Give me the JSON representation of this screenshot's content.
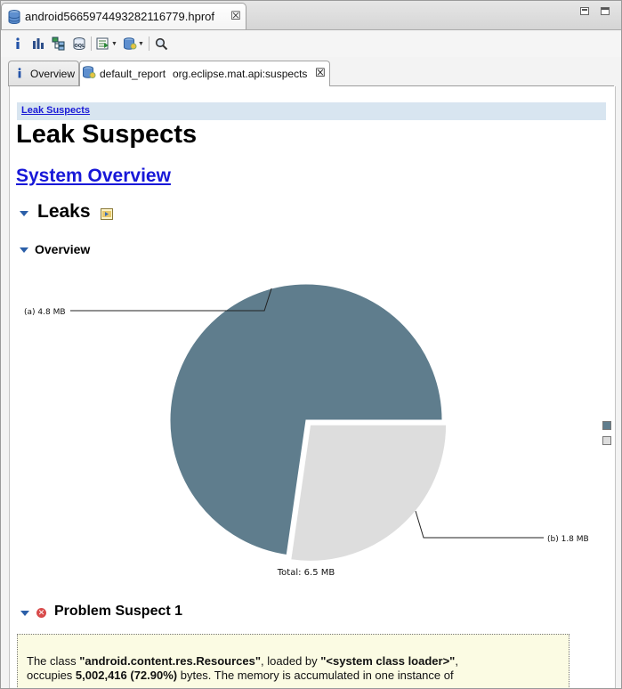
{
  "editor": {
    "file_tab": "android5665974493282116779.hprof"
  },
  "toolbar": {
    "icons": [
      "info-icon",
      "histogram-icon",
      "dominator-tree-icon",
      "oql-icon",
      "run-report-icon",
      "query-browser-icon",
      "search-icon"
    ]
  },
  "tabs": {
    "overview": "Overview",
    "report_name": "default_report",
    "report_id": "org.eclipse.mat.api:suspects"
  },
  "report": {
    "breadcrumb": "Leak Suspects",
    "title": "Leak Suspects",
    "system_overview_link": "System Overview",
    "leaks_heading": "Leaks",
    "overview_heading": "Overview",
    "problem_suspect_title": "Problem Suspect 1",
    "suspect_text": {
      "p1": "The class ",
      "class_name": "\"android.content.res.Resources\"",
      "p2": ", loaded by ",
      "loader": "\"<system class loader>\"",
      "p3": ",",
      "p4": "occupies ",
      "size": "5,002,416 (72.90%)",
      "p5": " bytes. The memory is accumulated in one instance of"
    }
  },
  "chart_data": {
    "type": "pie",
    "slices": [
      {
        "label": "(a)  4.8 MB",
        "value": 4.8,
        "color": "#5f7d8d"
      },
      {
        "label": "(b)  1.8 MB",
        "value": 1.8,
        "color": "#dddddd"
      }
    ],
    "total_label": "Total: 6.5 MB",
    "exploded_slice": "(b)  1.8 MB"
  }
}
